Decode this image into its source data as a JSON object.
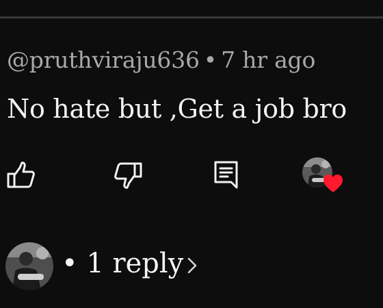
{
  "comment": {
    "author": "@pruthviraju636",
    "separator": "•",
    "time": "7 hr ago",
    "text": "No hate but ,Get a job bro"
  },
  "actions": {
    "like_icon": "thumbs-up-icon",
    "dislike_icon": "thumbs-down-icon",
    "reply_icon": "comment-icon",
    "creator_heart_icon": "heart-icon",
    "heart_color": "#ff1a2d"
  },
  "replies": {
    "bullet": "•",
    "label": "1 reply",
    "chevron_icon": "chevron-right-icon"
  },
  "colors": {
    "background": "#0d0d0e",
    "meta_text": "#a9a9a9",
    "primary_text": "#f4f4f4"
  }
}
